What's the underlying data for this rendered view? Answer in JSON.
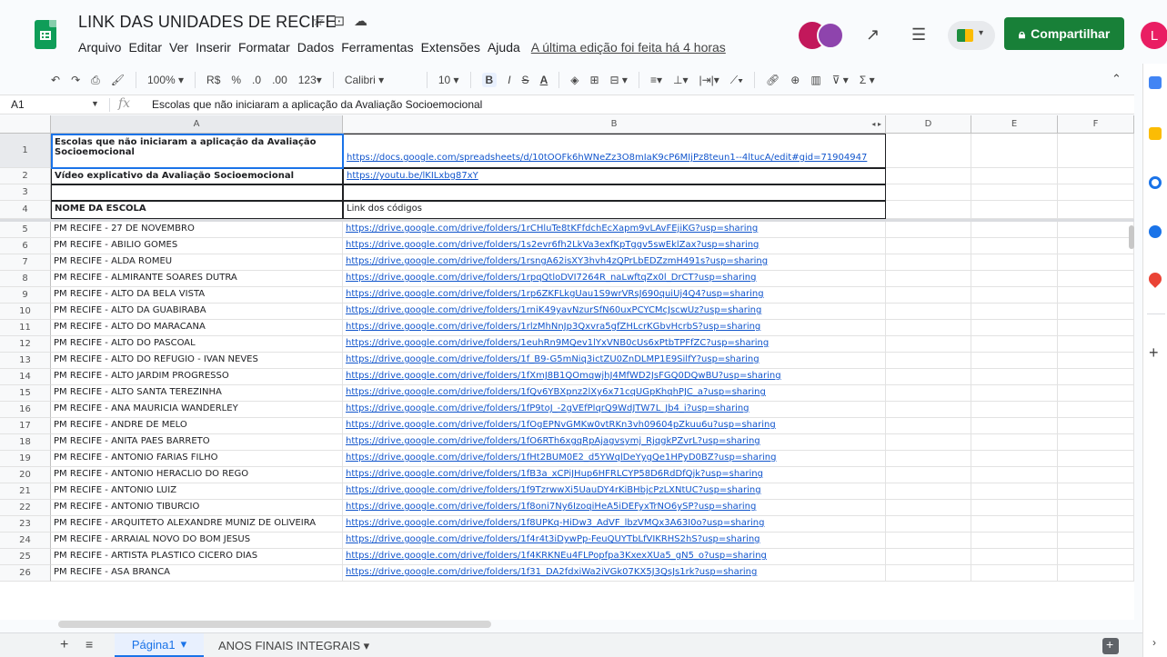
{
  "header": {
    "title": "LINK DAS UNIDADES DE RECIFE",
    "menu": [
      "Arquivo",
      "Editar",
      "Ver",
      "Inserir",
      "Formatar",
      "Dados",
      "Ferramentas",
      "Extensões",
      "Ajuda"
    ],
    "last_edit": "A última edição foi feita há 4 horas",
    "share_label": "Compartilhar",
    "user_initial": "L"
  },
  "toolbar": {
    "zoom": "100%",
    "currency": "R$",
    "percent": "%",
    "dec_less": ".0",
    "dec_more": ".00",
    "format_more": "123",
    "font": "Calibri",
    "size": "10",
    "bold": "B",
    "italic": "I",
    "strike": "S",
    "text_color": "A"
  },
  "formula_bar": {
    "cell_ref": "A1",
    "fx": "fx",
    "content": "Escolas que não iniciaram a aplicação da Avaliação Socioemocional"
  },
  "columns": [
    "A",
    "B",
    "D",
    "E",
    "F"
  ],
  "rows": [
    {
      "n": "1",
      "a": "Escolas que não iniciaram a aplicação da Avaliação Socioemocional",
      "b": "https://docs.google.com/spreadsheets/d/10tOOFk6hWNeZz3O8mIaK9cP6MIjPz8teun1--4ltucA/edit#gid=71904947"
    },
    {
      "n": "2",
      "a": "Vídeo explicativo da Avaliação Socioemocional",
      "b": "https://youtu.be/lKILxbg87xY"
    },
    {
      "n": "3",
      "a": "",
      "b": ""
    },
    {
      "n": "4",
      "a": "NOME DA ESCOLA",
      "b": "Link dos códigos"
    },
    {
      "n": "5",
      "a": "PM RECIFE - 27 DE NOVEMBRO",
      "b": "https://drive.google.com/drive/folders/1rCHluTe8tKFfdchEcXapm9vLAvFEjiKG?usp=sharing"
    },
    {
      "n": "6",
      "a": "PM RECIFE - ABILIO GOMES",
      "b": "https://drive.google.com/drive/folders/1s2evr6fh2LkVa3exfKpTggv5swEklZax?usp=sharing"
    },
    {
      "n": "7",
      "a": "PM RECIFE - ALDA ROMEU",
      "b": "https://drive.google.com/drive/folders/1rsngA62isXY3hvh4zQPrLbEDZzmH491s?usp=sharing"
    },
    {
      "n": "8",
      "a": "PM RECIFE - ALMIRANTE SOARES DUTRA",
      "b": "https://drive.google.com/drive/folders/1rpqQtloDVI7264R_naLwftqZx0l_DrCT?usp=sharing"
    },
    {
      "n": "9",
      "a": "PM RECIFE - ALTO DA BELA VISTA",
      "b": "https://drive.google.com/drive/folders/1rp6ZKFLkgUau1S9wrVRsJ690quiUj4Q4?usp=sharing"
    },
    {
      "n": "10",
      "a": "PM RECIFE - ALTO DA GUABIRABA",
      "b": "https://drive.google.com/drive/folders/1rniK49yavNzurSfN60uxPCYCMcJscwUz?usp=sharing"
    },
    {
      "n": "11",
      "a": "PM RECIFE - ALTO DO MARACANA",
      "b": "https://drive.google.com/drive/folders/1rlzMhNnJp3Qxvra5gfZHLcrKGbvHcrbS?usp=sharing"
    },
    {
      "n": "12",
      "a": "PM RECIFE - ALTO DO PASCOAL",
      "b": "https://drive.google.com/drive/folders/1euhRn9MQev1lYxVNB0cUs6xPtbTPFfZC?usp=sharing"
    },
    {
      "n": "13",
      "a": "PM RECIFE - ALTO DO REFUGIO - IVAN NEVES",
      "b": "https://drive.google.com/drive/folders/1f_B9-G5mNiq3ictZU0ZnDLMP1E9SilfY?usp=sharing"
    },
    {
      "n": "14",
      "a": "PM RECIFE - ALTO JARDIM PROGRESSO",
      "b": "https://drive.google.com/drive/folders/1fXmJ8B1QOmqwjhJ4MfWD2JsFGQ0DQwBU?usp=sharing"
    },
    {
      "n": "15",
      "a": "PM RECIFE - ALTO SANTA TEREZINHA",
      "b": "https://drive.google.com/drive/folders/1fQv6YBXpnz2lXy6x71cqUGpKhqhPJC_a?usp=sharing"
    },
    {
      "n": "16",
      "a": "PM RECIFE - ANA MAURICIA WANDERLEY",
      "b": "https://drive.google.com/drive/folders/1fP9toJ_-2gVEfPlqrQ9WdJTW7L_Jb4_i?usp=sharing"
    },
    {
      "n": "17",
      "a": "PM RECIFE - ANDRE DE MELO",
      "b": "https://drive.google.com/drive/folders/1fOgEPNvGMKw0vtRKn3vh09604pZkuu6u?usp=sharing"
    },
    {
      "n": "18",
      "a": "PM RECIFE - ANITA PAES BARRETO",
      "b": "https://drive.google.com/drive/folders/1fO6RTh6xgqRpAjagvsymj_RjqgkPZvrL?usp=sharing"
    },
    {
      "n": "19",
      "a": "PM RECIFE - ANTONIO FARIAS FILHO",
      "b": "https://drive.google.com/drive/folders/1fHt2BUM0E2_d5YWqlDeYygQe1HPyD0BZ?usp=sharing"
    },
    {
      "n": "20",
      "a": "PM RECIFE - ANTONIO HERACLIO DO REGO",
      "b": "https://drive.google.com/drive/folders/1fB3a_xCPiJHup6HFRLCYP58D6RdDfQjk?usp=sharing"
    },
    {
      "n": "21",
      "a": "PM RECIFE - ANTONIO LUIZ",
      "b": "https://drive.google.com/drive/folders/1f9TzrwwXi5UauDY4rKiBHbjcPzLXNtUC?usp=sharing"
    },
    {
      "n": "22",
      "a": "PM RECIFE - ANTONIO TIBURCIO",
      "b": "https://drive.google.com/drive/folders/1f8oni7Ny6IzoqiHeA5iDEFyxTrNO6ySP?usp=sharing"
    },
    {
      "n": "23",
      "a": "PM RECIFE - ARQUITETO ALEXANDRE MUNIZ DE OLIVEIRA",
      "b": "https://drive.google.com/drive/folders/1f8UPKq-HiDw3_AdVF_lbzVMQx3A63I0o?usp=sharing"
    },
    {
      "n": "24",
      "a": "PM RECIFE - ARRAIAL NOVO DO BOM JESUS",
      "b": "https://drive.google.com/drive/folders/1f4r4t3iDywPp-FeuQUYTbLfVIKRHS2hS?usp=sharing"
    },
    {
      "n": "25",
      "a": "PM RECIFE - ARTISTA PLASTICO CICERO DIAS",
      "b": "https://drive.google.com/drive/folders/1f4KRKNEu4FLPopfpa3KxexXUa5_gN5_o?usp=sharing"
    },
    {
      "n": "26",
      "a": "PM RECIFE - ASA BRANCA",
      "b": "https://drive.google.com/drive/folders/1f31_DA2fdxiWa2iVGk07KX5J3QsJs1rk?usp=sharing"
    }
  ],
  "sheets": {
    "active": "Página1",
    "other": "ANOS FINAIS INTEGRAIS"
  },
  "colors": {
    "sheets_green": "#0f9d58",
    "share_green": "#188038",
    "link_blue": "#1155cc",
    "selection_blue": "#1a73e8"
  }
}
